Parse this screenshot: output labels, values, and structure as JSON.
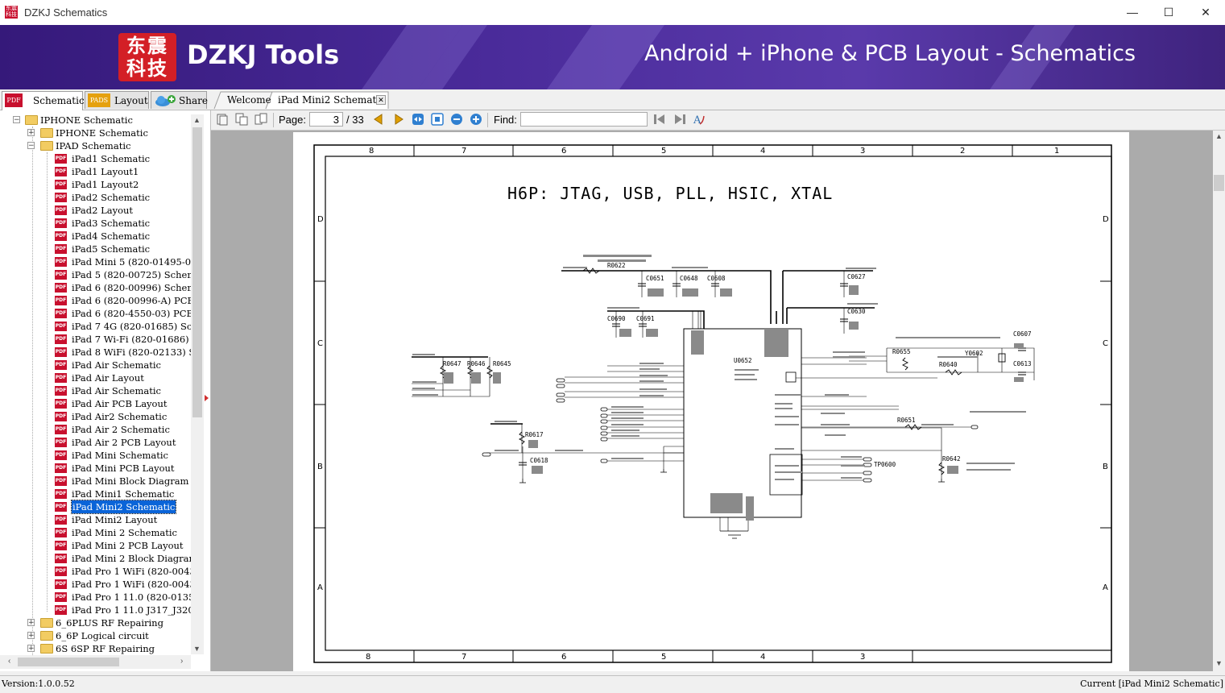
{
  "window": {
    "title": "DZKJ Schematics",
    "minimize": "—",
    "maximize": "☐",
    "close": "✕"
  },
  "banner": {
    "logo_line1": "东震",
    "logo_line2": "科技",
    "brand": "DZKJ Tools",
    "tagline": "Android + iPhone & PCB Layout - Schematics"
  },
  "left_tabs": [
    {
      "icon_text": "PDF",
      "label": "Schematic"
    },
    {
      "icon_text": "PADS",
      "label": "Layout"
    },
    {
      "icon_text": "",
      "label": "Share"
    }
  ],
  "doc_tabs": [
    {
      "label": "Welcome"
    },
    {
      "label": "iPad Mini2 Schematic",
      "close": "✕"
    }
  ],
  "tree": [
    {
      "label": "IPHONE Schematic",
      "level": 0,
      "type": "folder",
      "expander": "−"
    },
    {
      "label": "IPHONE Schematic",
      "level": 1,
      "type": "folder",
      "expander": "+"
    },
    {
      "label": "IPAD Schematic",
      "level": 1,
      "type": "folder",
      "expander": "−"
    },
    {
      "label": "iPad1 Schematic",
      "level": 2,
      "type": "pdf"
    },
    {
      "label": "iPad1 Layout1",
      "level": 2,
      "type": "pdf"
    },
    {
      "label": "iPad1 Layout2",
      "level": 2,
      "type": "pdf"
    },
    {
      "label": "iPad2 Schematic",
      "level": 2,
      "type": "pdf"
    },
    {
      "label": "iPad2 Layout",
      "level": 2,
      "type": "pdf"
    },
    {
      "label": "iPad3 Schematic",
      "level": 2,
      "type": "pdf"
    },
    {
      "label": "iPad4 Schematic",
      "level": 2,
      "type": "pdf"
    },
    {
      "label": "iPad5 Schematic",
      "level": 2,
      "type": "pdf"
    },
    {
      "label": "iPad Mini 5 (820-01495-08",
      "level": 2,
      "type": "pdf"
    },
    {
      "label": "iPad 5 (820-00725) Schema",
      "level": 2,
      "type": "pdf"
    },
    {
      "label": "iPad 6 (820-00996) Schema",
      "level": 2,
      "type": "pdf"
    },
    {
      "label": "iPad 6 (820-00996-A) PCB",
      "level": 2,
      "type": "pdf"
    },
    {
      "label": "iPad 6 (820-4550-03) PCB",
      "level": 2,
      "type": "pdf"
    },
    {
      "label": "iPad 7 4G (820-01685) Sch",
      "level": 2,
      "type": "pdf"
    },
    {
      "label": "iPad 7 Wi-Fi (820-01686)",
      "level": 2,
      "type": "pdf"
    },
    {
      "label": "iPad 8 WiFi (820-02133) S",
      "level": 2,
      "type": "pdf"
    },
    {
      "label": "iPad Air Schematic",
      "level": 2,
      "type": "pdf"
    },
    {
      "label": "iPad Air Layout",
      "level": 2,
      "type": "pdf"
    },
    {
      "label": "iPad Air Schematic",
      "level": 2,
      "type": "pdf"
    },
    {
      "label": "iPad Air PCB Layout",
      "level": 2,
      "type": "pdf"
    },
    {
      "label": "iPad Air2 Schematic",
      "level": 2,
      "type": "pdf"
    },
    {
      "label": "iPad Air 2 Schematic",
      "level": 2,
      "type": "pdf"
    },
    {
      "label": "iPad Air 2 PCB Layout",
      "level": 2,
      "type": "pdf"
    },
    {
      "label": "iPad Mini Schematic",
      "level": 2,
      "type": "pdf"
    },
    {
      "label": "iPad Mini PCB Layout",
      "level": 2,
      "type": "pdf"
    },
    {
      "label": "iPad Mini Block Diagram",
      "level": 2,
      "type": "pdf"
    },
    {
      "label": "iPad Mini1 Schematic",
      "level": 2,
      "type": "pdf"
    },
    {
      "label": "iPad Mini2 Schematic",
      "level": 2,
      "type": "pdf",
      "selected": true
    },
    {
      "label": "iPad Mini2 Layout",
      "level": 2,
      "type": "pdf"
    },
    {
      "label": "iPad Mini 2 Schematic",
      "level": 2,
      "type": "pdf"
    },
    {
      "label": "iPad Mini 2 PCB Layout",
      "level": 2,
      "type": "pdf"
    },
    {
      "label": "iPad Mini 2 Block Diagram",
      "level": 2,
      "type": "pdf"
    },
    {
      "label": "iPad Pro 1 WiFi (820-0043",
      "level": 2,
      "type": "pdf"
    },
    {
      "label": "iPad Pro 1 WiFi (820-0043",
      "level": 2,
      "type": "pdf"
    },
    {
      "label": "iPad Pro 1 11.0 (820-0135",
      "level": 2,
      "type": "pdf"
    },
    {
      "label": "iPad Pro 1 11.0 J317_J320",
      "level": 2,
      "type": "pdf"
    },
    {
      "label": "6_6PLUS RF Repairing",
      "level": 1,
      "type": "folder",
      "expander": "+"
    },
    {
      "label": "6_6P Logical circuit",
      "level": 1,
      "type": "folder",
      "expander": "+"
    },
    {
      "label": "6S 6SP RF Repairing",
      "level": 1,
      "type": "folder",
      "expander": "+"
    }
  ],
  "toolbar": {
    "page_label": "Page:",
    "page_current": "3",
    "page_total": "/ 33",
    "find_label": "Find:",
    "find_value": ""
  },
  "schematic": {
    "title": "H6P: JTAG, USB, PLL, HSIC, XTAL",
    "columns_top": [
      "8",
      "7",
      "6",
      "5",
      "4",
      "3",
      "2",
      "1"
    ],
    "columns_bottom": [
      "8",
      "7",
      "6",
      "5",
      "4",
      "3"
    ],
    "rows": [
      "D",
      "C",
      "B",
      "A"
    ],
    "refdes": [
      "C0651",
      "C0648",
      "C0608",
      "C0627",
      "C0630",
      "C0690",
      "C0691",
      "R0647",
      "R0646",
      "R0645",
      "U0652",
      "R0655",
      "C0607",
      "Y0602",
      "R0640",
      "C0613",
      "R0651",
      "R0617",
      "C0618",
      "TP0600",
      "R0642",
      "R0622"
    ]
  },
  "status": {
    "version": "Version:1.0.0.52",
    "current": "Current [iPad Mini2 Schematic]"
  }
}
